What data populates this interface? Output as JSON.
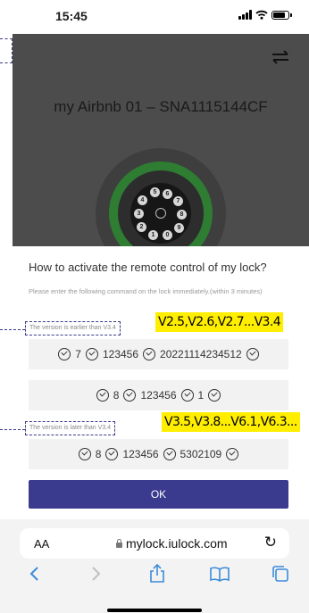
{
  "status_bar": {
    "time": "15:45"
  },
  "hero": {
    "device_title": "my Airbnb 01 – SNA1115144CF",
    "keypad_keys": [
      "5",
      "6",
      "7",
      "4",
      "8",
      "3",
      "9",
      "2",
      "0",
      "1"
    ]
  },
  "dialog": {
    "question": "How to activate the remote control of my lock?",
    "instruction": "Please enter the following command on the lock immediately.(within 3 minutes)",
    "version_early": "The version is earlier than V3.4",
    "version_late": "The version is later than V3.4",
    "highlight_early": "V2.5,V2.6,V2.7...V3.4",
    "highlight_late": "V3.5,V3.8...V6.1,V6.3...",
    "command_1": [
      "7",
      "123456",
      "20221114234512"
    ],
    "command_2": [
      "8",
      "123456",
      "1"
    ],
    "command_3": [
      "8",
      "123456",
      "5302109"
    ],
    "ok_label": "OK"
  },
  "browser": {
    "aa_label": "AA",
    "url": "mylock.iulock.com"
  },
  "colors": {
    "accent": "#3a3a8e",
    "highlight": "#ffee00",
    "ring": "#2e7d32"
  }
}
